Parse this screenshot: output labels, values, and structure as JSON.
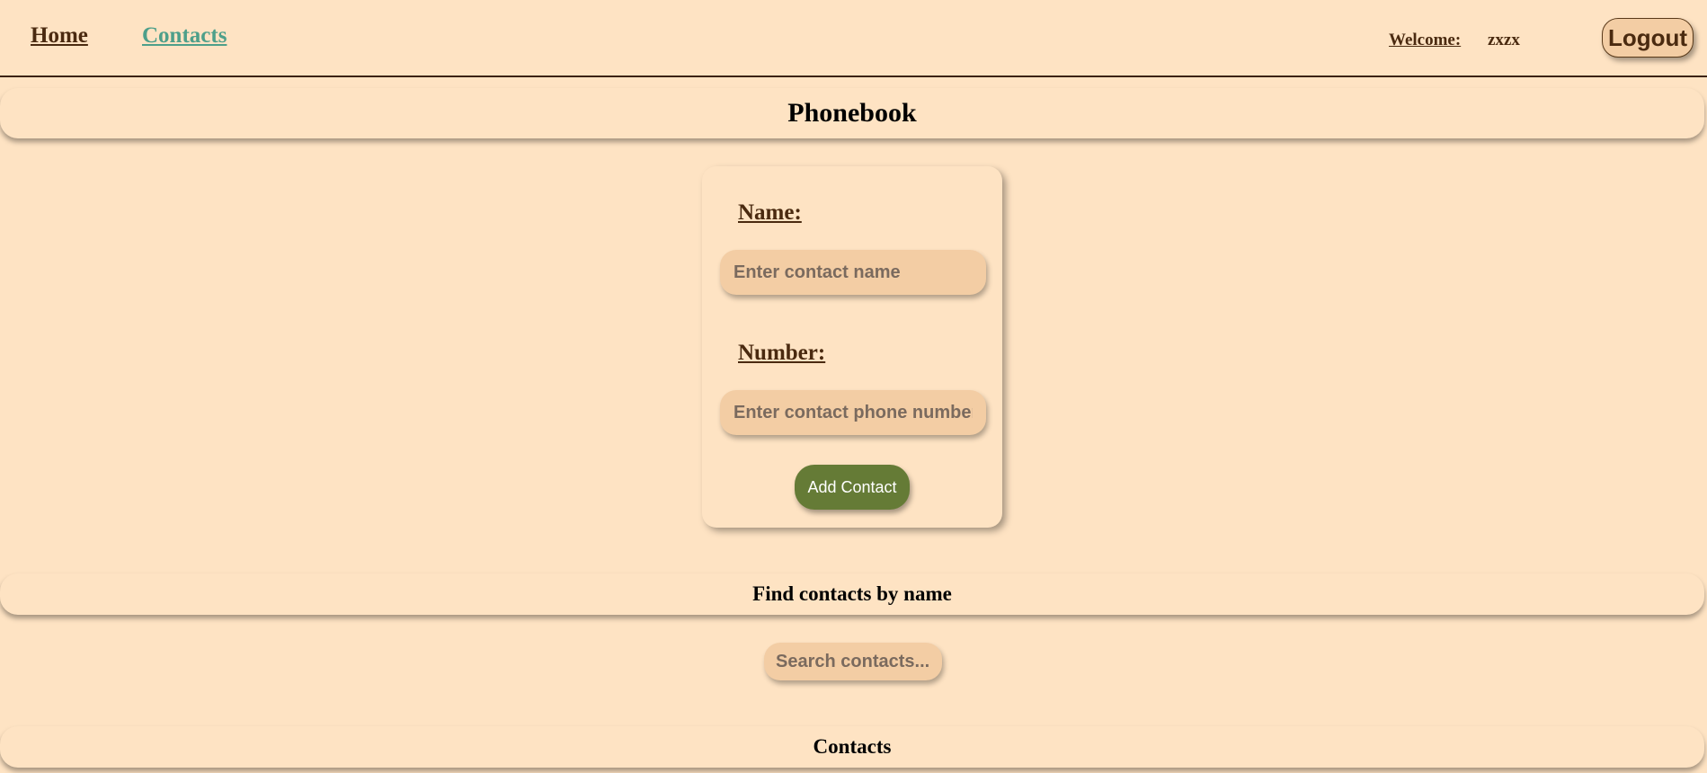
{
  "nav": {
    "home_label": "Home",
    "contacts_label": "Contacts"
  },
  "user": {
    "welcome_label": "Welcome:",
    "username": "zxzx",
    "logout_label": "Logout"
  },
  "page": {
    "title": "Phonebook"
  },
  "form": {
    "name_label": "Name:",
    "name_placeholder": "Enter contact name",
    "name_value": "",
    "number_label": "Number:",
    "number_placeholder": "Enter contact phone number",
    "number_value": "",
    "submit_label": "Add Contact"
  },
  "filter": {
    "heading": "Find contacts by name",
    "placeholder": "Search contacts...",
    "value": ""
  },
  "contacts": {
    "heading": "Contacts"
  },
  "colors": {
    "background": "#fee3c3",
    "input_background": "#f3cda4",
    "accent_green": "#657b36",
    "link_active": "#4d9f8a",
    "text_brown": "#4a2a10"
  }
}
